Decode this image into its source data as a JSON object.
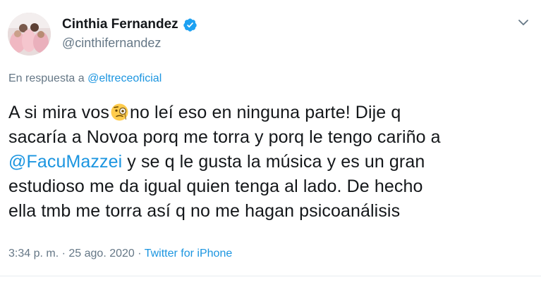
{
  "header": {
    "display_name": "Cinthia Fernandez",
    "handle": "@cinthifernandez",
    "verified_icon": "verified-badge-icon",
    "menu_icon": "chevron-down-icon"
  },
  "reply": {
    "prefix": "En respuesta a",
    "mention": "@eltreceoficial"
  },
  "tweet": {
    "line1_a": "A si mira vos",
    "emoji": "face-with-monocle-icon",
    "line1_b": "no leí eso en ninguna parte! Dije q",
    "line2": "sacaría a Novoa porq me torra y porq le tengo cariño a",
    "line3_mention": "@FacuMazzei",
    "line3_rest": " y se q le gusta la música y es un gran",
    "line4": "estudioso me da igual quien tenga al lado. De hecho",
    "line5": "ella tmb me torra así q no me hagan psicoanálisis"
  },
  "meta": {
    "time": "3:34 p. m.",
    "separator1": " · ",
    "date": "25 ago. 2020",
    "separator2": " · ",
    "source": "Twitter for iPhone"
  },
  "colors": {
    "link": "#1b95e0",
    "secondary_text": "#657786",
    "primary_text": "#14171a"
  }
}
